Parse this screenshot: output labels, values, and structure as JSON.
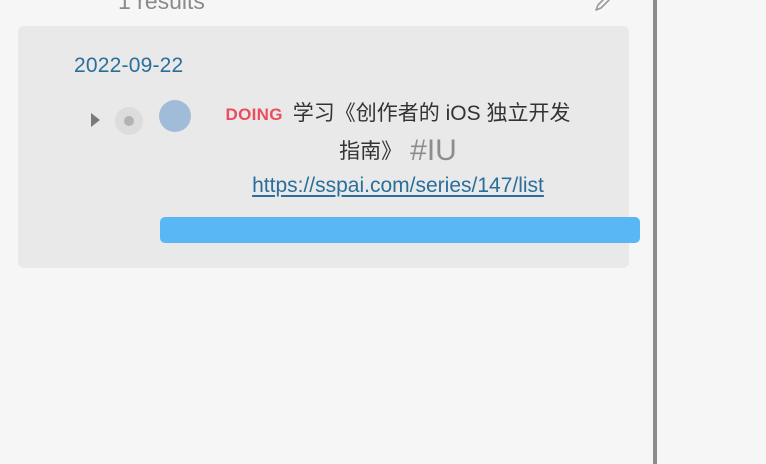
{
  "search": {
    "results_label": "1 results"
  },
  "result": {
    "date": "2022-09-22",
    "block": {
      "marker": "DOING",
      "text_line1": "学习《创作者的 iOS 独立开发",
      "text_line2": "指南》",
      "tag": "#IU",
      "url": "https://sspai.com/series/147/list"
    }
  },
  "colors": {
    "background": "#f6f6f6",
    "card": "#e9e9e9",
    "link": "#2a6f9b",
    "doing_marker": "#ea4d5d",
    "bullet": "#a0bcd8",
    "embed_bar": "#5ab7f6",
    "divider": "#8c8c8c"
  },
  "icons": {
    "caret": "caret-right-icon",
    "edit": "pencil-icon"
  }
}
